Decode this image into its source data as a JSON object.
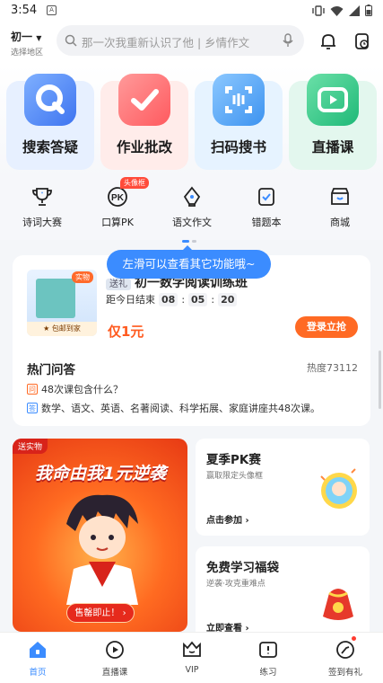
{
  "status_bar": {
    "time": "3:54",
    "notification_glyph": "A"
  },
  "header": {
    "grade": "初一",
    "grade_sub": "选择地区",
    "search_placeholder": "那一次我重新认识了他 | 乡情作文"
  },
  "tiles": [
    {
      "label": "搜索答疑",
      "icon": "search-q-icon",
      "color": "#5b8df6"
    },
    {
      "label": "作业批改",
      "icon": "check-icon",
      "color": "#ff6d6d"
    },
    {
      "label": "扫码搜书",
      "icon": "scan-icon",
      "color": "#4aa3f6"
    },
    {
      "label": "直播课",
      "icon": "play-icon",
      "color": "#32c98a"
    }
  ],
  "shortcuts": [
    {
      "label": "诗词大赛",
      "icon": "trophy-icon"
    },
    {
      "label": "口算PK",
      "icon": "pk-icon",
      "badge": "头像框"
    },
    {
      "label": "语文作文",
      "icon": "pen-nib-icon"
    },
    {
      "label": "错题本",
      "icon": "wrong-book-icon"
    },
    {
      "label": "商城",
      "icon": "shop-icon"
    }
  ],
  "tooltip": "左滑可以查看其它功能哦~",
  "course_card": {
    "tag": "送礼",
    "title": "初一数学阅读训练班",
    "countdown_label": "距今日结束",
    "countdown": [
      "08",
      "05",
      "20"
    ],
    "price": "仅1元",
    "buy_label": "登录立抢",
    "book_badge": "实物",
    "book_ship": "包邮到家",
    "hot_title": "热门问答",
    "hot_count": "热度73112",
    "qa_question_mark": "问",
    "qa_question": "48次课包含什么？",
    "qa_answer_mark": "答",
    "qa_answer": "数学、语文、英语、名著阅读、科学拓展、家庭讲座共48次课。"
  },
  "promo": {
    "ribbon": "送实物",
    "headline": "我命由我1元逆袭",
    "button": "售罄即止！ ›"
  },
  "side_cards": [
    {
      "title": "夏季PK赛",
      "subtitle": "赢取限定头像框",
      "link": "点击参加 ›"
    },
    {
      "title": "免费学习福袋",
      "subtitle": "逆袭·攻克重难点",
      "link": "立即查看 ›"
    }
  ],
  "tabbar": [
    {
      "label": "首页",
      "icon": "home-icon",
      "active": true
    },
    {
      "label": "直播课",
      "icon": "live-icon",
      "active": false
    },
    {
      "label": "VIP",
      "icon": "vip-icon",
      "active": false
    },
    {
      "label": "练习",
      "icon": "practice-icon",
      "active": false
    },
    {
      "label": "签到有礼",
      "icon": "checkin-icon",
      "active": false
    }
  ],
  "colors": {
    "accent": "#3b8cff",
    "orange": "#ff6a24"
  }
}
